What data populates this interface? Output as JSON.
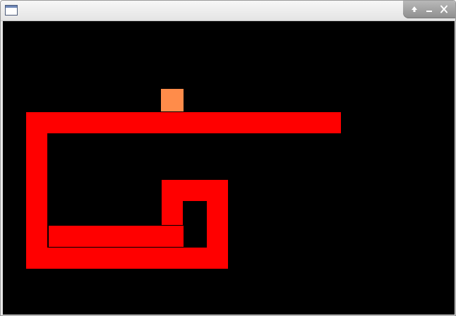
{
  "window": {
    "icon": "window-icon",
    "controls": [
      "maximize-icon",
      "minimize-icon",
      "close-icon"
    ]
  },
  "game": {
    "board_color": "#000000",
    "snake_color": "#ff0000",
    "food_color": "#ff8c4a",
    "snake_outline_color": "#000000",
    "food_present": true
  }
}
